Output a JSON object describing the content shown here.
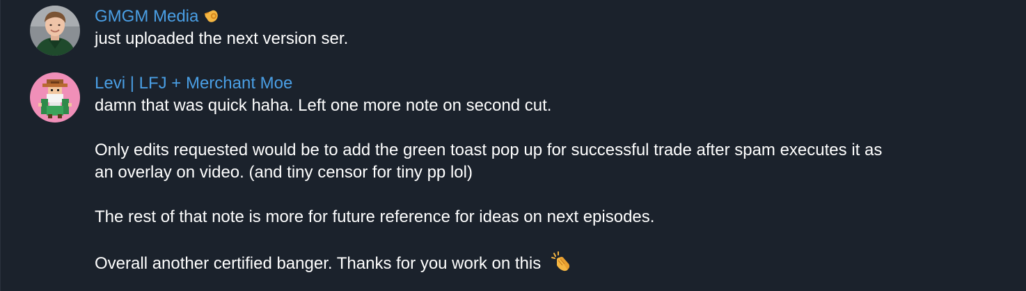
{
  "messages": [
    {
      "sender": "GMGM Media",
      "sender_badge": "ok-hand-emoji",
      "avatar": "user-photo-avatar",
      "paragraphs": [
        "just uploaded the next version ser."
      ]
    },
    {
      "sender": "Levi | LFJ + Merchant Moe",
      "avatar": "pixel-art-wizard-avatar",
      "paragraphs": [
        "damn that was quick haha. Left one more note on second cut.",
        "Only edits requested would be to add the green toast pop up for successful trade after spam executes it as",
        "an overlay on video. (and tiny censor for tiny pp lol)",
        "The rest of that note is more for future reference for ideas on next episodes.",
        "Overall another certified banger. Thanks for you work on this"
      ],
      "trailing_emoji": "clapping-hands-emoji"
    }
  ],
  "colors": {
    "background": "#1b222c",
    "sender_name": "#4a9fe5",
    "message_text": "#ffffff",
    "avatar2_background": "#f08fb8"
  }
}
